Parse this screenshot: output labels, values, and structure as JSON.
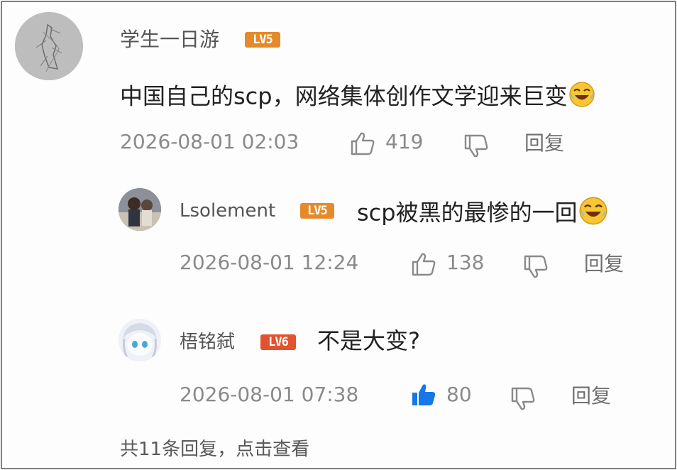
{
  "main_comment": {
    "username": "学生一日游",
    "level": "LV5",
    "text": "中国自己的scp，网络集体创作文学迎来巨变",
    "emoji": "crying-laughing-emoji",
    "timestamp": "2026-08-01 02:03",
    "likes": "419",
    "reply_label": "回复"
  },
  "replies": [
    {
      "username": "Lsolement",
      "level": "LV5",
      "text": "scp被黑的最惨的一回",
      "emoji": "crying-laughing-emoji",
      "timestamp": "2026-08-01 12:24",
      "likes": "138",
      "reply_label": "回复",
      "liked": false
    },
    {
      "username": "梧铭弑",
      "level": "LV6",
      "text": "不是大变?",
      "timestamp": "2026-08-01 07:38",
      "likes": "80",
      "reply_label": "回复",
      "liked": true
    }
  ],
  "footer": {
    "view_more": "共11条回复，点击查看"
  },
  "colors": {
    "like_active": "#1677e8",
    "badge_lv5": "#e58a2a",
    "badge_lv6": "#e2522f"
  }
}
